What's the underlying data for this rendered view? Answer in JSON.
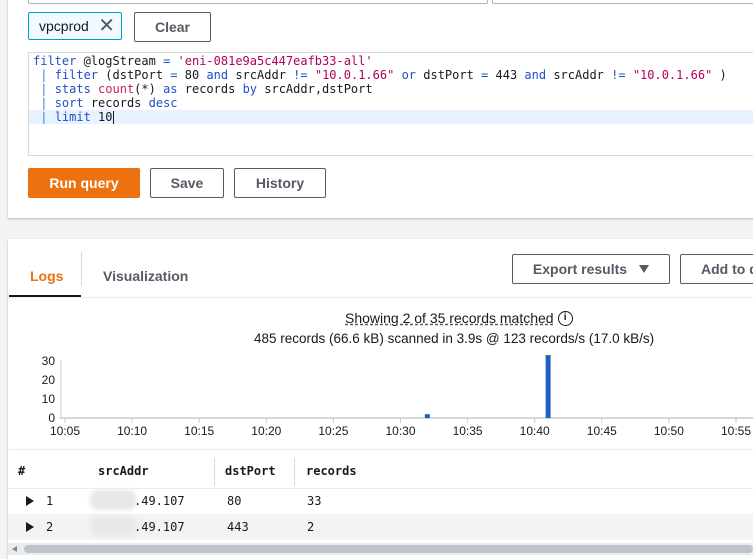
{
  "query": {
    "token_label": "vpcprod",
    "clear_label": "Clear",
    "lines": [
      [
        {
          "t": "filter",
          "c": "kw"
        },
        {
          "t": " @logStream ",
          "c": "pl"
        },
        {
          "t": "=",
          "c": "kw"
        },
        {
          "t": " ",
          "c": "pl"
        },
        {
          "t": "'eni-081e9a5c447eafb33-all'",
          "c": "str"
        }
      ],
      [
        {
          "t": " | ",
          "c": "bar"
        },
        {
          "t": "filter",
          "c": "kw"
        },
        {
          "t": " (dstPort ",
          "c": "pl"
        },
        {
          "t": "=",
          "c": "kw"
        },
        {
          "t": " 80 ",
          "c": "pl"
        },
        {
          "t": "and",
          "c": "kw"
        },
        {
          "t": " srcAddr ",
          "c": "pl"
        },
        {
          "t": "!=",
          "c": "kw"
        },
        {
          "t": " ",
          "c": "pl"
        },
        {
          "t": "\"10.0.1.66\"",
          "c": "str"
        },
        {
          "t": " ",
          "c": "pl"
        },
        {
          "t": "or",
          "c": "kw"
        },
        {
          "t": " dstPort ",
          "c": "pl"
        },
        {
          "t": "=",
          "c": "kw"
        },
        {
          "t": " 443 ",
          "c": "pl"
        },
        {
          "t": "and",
          "c": "kw"
        },
        {
          "t": " srcAddr ",
          "c": "pl"
        },
        {
          "t": "!=",
          "c": "kw"
        },
        {
          "t": " ",
          "c": "pl"
        },
        {
          "t": "\"10.0.1.66\"",
          "c": "str"
        },
        {
          "t": " )",
          "c": "pl"
        }
      ],
      [
        {
          "t": " | ",
          "c": "bar"
        },
        {
          "t": "stats",
          "c": "kw"
        },
        {
          "t": " ",
          "c": "pl"
        },
        {
          "t": "count",
          "c": "fn"
        },
        {
          "t": "(*) ",
          "c": "pl"
        },
        {
          "t": "as",
          "c": "kw"
        },
        {
          "t": " records ",
          "c": "pl"
        },
        {
          "t": "by",
          "c": "kw"
        },
        {
          "t": " srcAddr,dstPort",
          "c": "pl"
        }
      ],
      [
        {
          "t": " | ",
          "c": "bar"
        },
        {
          "t": "sort",
          "c": "kw"
        },
        {
          "t": " records ",
          "c": "pl"
        },
        {
          "t": "desc",
          "c": "kw"
        }
      ],
      [
        {
          "t": " | ",
          "c": "bar"
        },
        {
          "t": "limit",
          "c": "kw"
        },
        {
          "t": " 10",
          "c": "pl"
        }
      ]
    ],
    "run_label": "Run query",
    "save_label": "Save",
    "history_label": "History"
  },
  "results": {
    "tabs": [
      "Logs",
      "Visualization"
    ],
    "export_label": "Export results",
    "add_label": "Add to d",
    "showing_text": "Showing 2 of 35 records matched",
    "scanned_text": "485 records (66.6 kB) scanned in 3.9s @ 123 records/s (17.0 kB/s)",
    "columns": [
      "#",
      "srcAddr",
      "dstPort",
      "records"
    ],
    "rows": [
      {
        "num": "1",
        "srcAddr": ".49.107",
        "dstPort": "80",
        "records": "33"
      },
      {
        "num": "2",
        "srcAddr": ".49.107",
        "dstPort": "443",
        "records": "2"
      }
    ]
  },
  "chart_data": {
    "type": "bar",
    "x_ticks": [
      "10:05",
      "10:10",
      "10:15",
      "10:20",
      "10:25",
      "10:30",
      "10:35",
      "10:40",
      "10:45",
      "10:50",
      "10:55"
    ],
    "y_ticks": [
      "0",
      "10",
      "20",
      "30"
    ],
    "ylim": [
      0,
      32
    ],
    "bars": [
      {
        "x": "10:32",
        "value": 2
      },
      {
        "x": "10:41",
        "value": 33
      }
    ],
    "bar_color": "#1f5fbf"
  },
  "colors": {
    "accent": "#ec7211",
    "link": "#0073bb"
  }
}
